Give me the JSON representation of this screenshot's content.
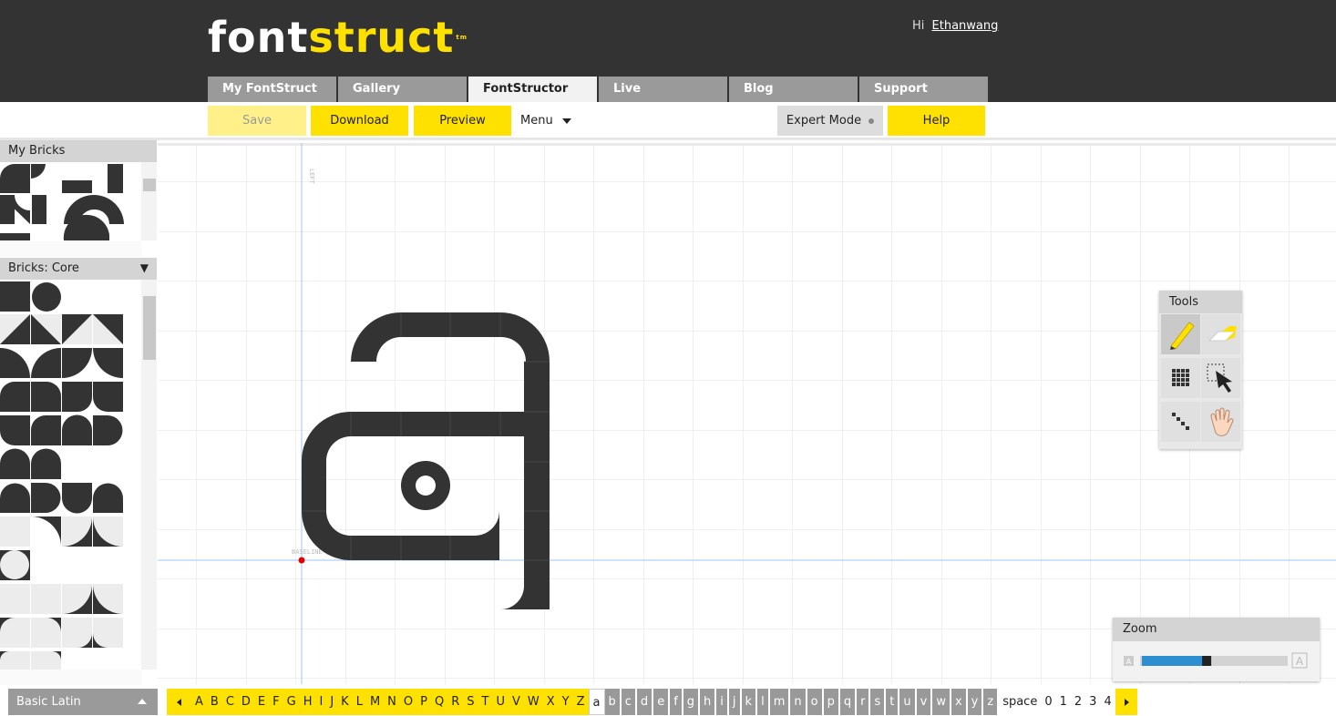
{
  "header": {
    "logo_part1": "font",
    "logo_part2": "struct",
    "logo_tm": "tm",
    "greeting": "Hi",
    "username": "Ethanwang"
  },
  "tabs": [
    {
      "label": "My FontStruct"
    },
    {
      "label": "Gallery"
    },
    {
      "label": "FontStructor",
      "active": true
    },
    {
      "label": "Live"
    },
    {
      "label": "Blog"
    },
    {
      "label": "Support"
    }
  ],
  "toolbar": {
    "save": "Save",
    "download": "Download",
    "preview": "Preview",
    "menu": "Menu",
    "expert_mode": "Expert Mode",
    "help": "Help"
  },
  "panels": {
    "my_bricks": "My Bricks",
    "bricks_core": "Bricks: Core"
  },
  "canvas": {
    "left_label": "LEFT",
    "baseline_label": "BASELINE",
    "glyph": "a"
  },
  "tools": {
    "title": "Tools",
    "items": [
      "pencil-tool",
      "eraser-tool",
      "fill-tool",
      "select-tool",
      "line-tool",
      "hand-tool"
    ]
  },
  "zoom": {
    "title": "Zoom",
    "level": 0.45
  },
  "bottom": {
    "charset": "Basic Latin",
    "filled_glyphs": [
      "A",
      "B",
      "C",
      "D",
      "E",
      "F",
      "G",
      "H",
      "I",
      "J",
      "K",
      "L",
      "M",
      "N",
      "O",
      "P",
      "Q",
      "R",
      "S",
      "T",
      "U",
      "V",
      "W",
      "X",
      "Y",
      "Z"
    ],
    "current_glyph": "a",
    "empty_glyphs": [
      "b",
      "c",
      "d",
      "e",
      "f",
      "g",
      "h",
      "i",
      "j",
      "k",
      "l",
      "m",
      "n",
      "o",
      "p",
      "q",
      "r",
      "s",
      "t",
      "u",
      "v",
      "w",
      "x",
      "y",
      "z"
    ],
    "trailing_glyphs": [
      "space",
      "0",
      "1",
      "2",
      "3",
      "4"
    ]
  },
  "colors": {
    "accent": "#ffe100",
    "header_bg": "#333333",
    "brick": "#333333",
    "guide": "#9cc8ec",
    "origin": "#e00000",
    "zoom_bar": "#2d8fcf"
  }
}
